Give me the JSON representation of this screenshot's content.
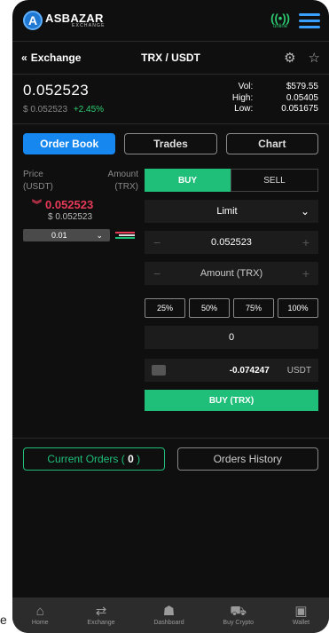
{
  "header": {
    "logo_letter": "A",
    "logo_name": "ASBAZAR",
    "logo_sub": "EXCHANGE",
    "online_label": "online"
  },
  "subbar": {
    "back_label": "Exchange",
    "pair": "TRX / USDT"
  },
  "ticker": {
    "last_price": "0.052523",
    "usd_price": "$ 0.052523",
    "change": "+2.45%",
    "vol_label": "Vol:",
    "vol_value": "$579.55",
    "high_label": "High:",
    "high_value": "0.05405",
    "low_label": "Low:",
    "low_value": "0.051675"
  },
  "tabs": [
    "Order Book",
    "Trades",
    "Chart"
  ],
  "order_book": {
    "price_header": "Price",
    "price_unit": "(USDT)",
    "amount_header": "Amount",
    "amount_unit": "(TRX)",
    "last_price": "0.052523",
    "last_usd": "$ 0.052523",
    "depth_value": "0.01"
  },
  "form": {
    "buy_label": "BUY",
    "sell_label": "SELL",
    "order_type": "Limit",
    "price_value": "0.052523",
    "amount_placeholder": "Amount (TRX)",
    "percents": [
      "25%",
      "50%",
      "75%",
      "100%"
    ],
    "quantity_value": "0",
    "total_value": "-0.074247",
    "total_currency": "USDT",
    "submit_label": "BUY (TRX)"
  },
  "orders": {
    "current_label": "Current Orders (",
    "current_count": "0",
    "current_close": ")",
    "history_label": "Orders History"
  },
  "nav": [
    "Home",
    "Exchange",
    "Dashboard",
    "Buy Crypto",
    "Wallet"
  ],
  "stray_text": "e",
  "colors": {
    "accent_blue": "#1787f0",
    "buy_green": "#1fbf7a",
    "sell_red": "#e63a57",
    "positive": "#2ecc71"
  },
  "icons": {
    "menu": "hamburger-icon",
    "online": "signal-icon",
    "back": "double-chevron-left-icon",
    "favorite": "star-icon",
    "settings": "gear-icon",
    "dropdown": "chevron-down-icon",
    "price_down": "double-chevron-down-icon",
    "wallet": "wallet-icon"
  }
}
